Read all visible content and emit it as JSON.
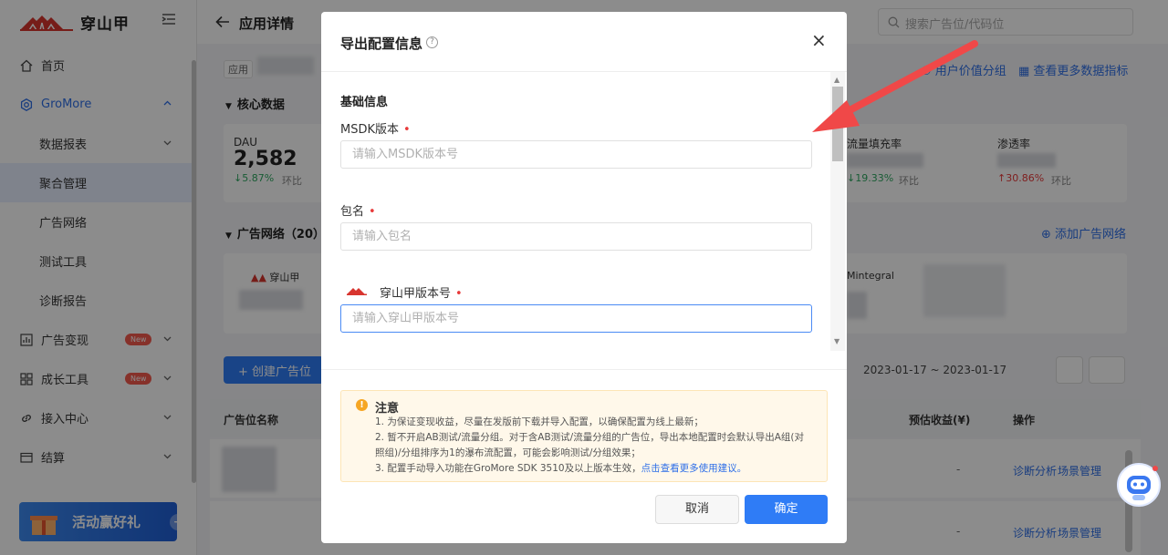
{
  "brand": {
    "name": "穿山甲"
  },
  "sidebar": {
    "items": [
      {
        "label": "首页",
        "icon": "home-icon"
      },
      {
        "label": "GroMore",
        "icon": "gear-icon"
      },
      {
        "label": "数据报表"
      },
      {
        "label": "聚合管理"
      },
      {
        "label": "广告网络"
      },
      {
        "label": "测试工具"
      },
      {
        "label": "诊断报告"
      },
      {
        "label": "广告变现",
        "badge": "New"
      },
      {
        "label": "成长工具",
        "badge": "New"
      },
      {
        "label": "接入中心"
      },
      {
        "label": "结算"
      }
    ],
    "promo": "活动赢好礼"
  },
  "topbar": {
    "title": "应用详情",
    "search_placeholder": "搜索广告位/代码位"
  },
  "main": {
    "app_tag": "应用",
    "core_data_title": "核心数据",
    "link_user_value": "用户价值分组",
    "link_more_metrics": "查看更多数据指标",
    "metrics": [
      {
        "label": "DAU",
        "value": "2,582",
        "change": "↓5.87%",
        "compare": "环比"
      },
      {
        "label": "流量填充率",
        "change": "↓19.33%",
        "compare": "环比"
      },
      {
        "label": "渗透率",
        "change": "↑30.86%",
        "compare": "环比"
      }
    ],
    "network_title": "广告网络（20）",
    "add_network": "添加广告网络",
    "network_cards": [
      "穿山甲",
      "Mintegral"
    ],
    "create_button": "创建广告位",
    "date_range": "2023-01-17 ~ 2023-01-17",
    "table": {
      "col_name": "广告位名称",
      "col_revenue": "预估收益(¥)",
      "col_ops": "操作",
      "rows": [
        {
          "revenue": "-",
          "op1": "诊断分析",
          "op2": "场景管理"
        },
        {
          "revenue": "-",
          "op1": "诊断分析",
          "op2": "场景管理"
        }
      ]
    }
  },
  "modal": {
    "title": "导出配置信息",
    "close": "×",
    "section": "基础信息",
    "fields": [
      {
        "label": "MSDK版本",
        "placeholder": "请输入MSDK版本号"
      },
      {
        "label": "包名",
        "placeholder": "请输入包名"
      },
      {
        "label": "穿山甲版本号",
        "placeholder": "请输入穿山甲版本号"
      }
    ],
    "notice": {
      "title": "注意",
      "line1": "1. 为保证变现收益，尽量在发版前下载并导入配置，以确保配置为线上最新；",
      "line2a": "2. 暂不开启AB测试/流量分组。对于含AB测试/流量分组的广告位，导出本地配置时会默认导出A组(对",
      "line2b": "照组)/分组排序为1的瀑布流配置，可能会影响测试/分组效果；",
      "line3": "3. 配置手动导入功能在GroMore SDK 3510及以上版本生效，",
      "line3_link": "点击查看更多使用建议。"
    },
    "cancel": "取消",
    "ok": "确定"
  },
  "colors": {
    "primary": "#2f7cf6",
    "brand_red": "#d8352f",
    "annotation": "#f04848"
  }
}
